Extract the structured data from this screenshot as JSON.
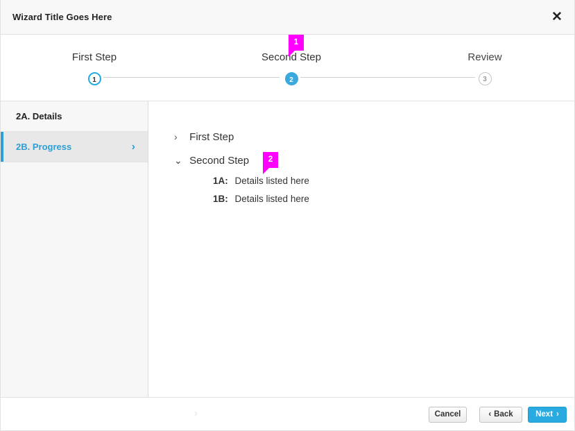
{
  "window": {
    "title": "Wizard Title Goes Here",
    "close_icon": "close-icon",
    "close_glyph": "✕"
  },
  "stepper": {
    "steps": [
      {
        "label": "First Step",
        "number": "1",
        "state": "current"
      },
      {
        "label": "Second Step",
        "number": "2",
        "state": "active"
      },
      {
        "label": "Review",
        "number": "3",
        "state": "inactive"
      }
    ],
    "callout": {
      "number": "1"
    }
  },
  "sidebar": {
    "items": [
      {
        "label": "2A. Details",
        "selected": false,
        "chevron": ""
      },
      {
        "label": "2B. Progress",
        "selected": true,
        "chevron": "›"
      }
    ]
  },
  "content": {
    "tree": [
      {
        "label": "First Step",
        "caret": "›",
        "expanded": false
      },
      {
        "label": "Second Step",
        "caret": "⌄",
        "expanded": true
      }
    ],
    "details": [
      {
        "key": "1A:",
        "text": "Details listed here"
      },
      {
        "key": "1B:",
        "text": "Details listed here"
      }
    ],
    "callout": {
      "number": "2"
    }
  },
  "footer": {
    "ghost_chevron": "›",
    "cancel_label": "Cancel",
    "back_label": "Back",
    "back_arrow": "‹",
    "next_label": "Next",
    "next_arrow": "›"
  },
  "colors": {
    "accent_blue": "#29abe2",
    "step_active": "#3aa9dd",
    "callout_magenta": "#ff00ff",
    "sidebar_bg": "#f7f7f7",
    "sidebar_selected_bg": "#e8e8e8"
  }
}
